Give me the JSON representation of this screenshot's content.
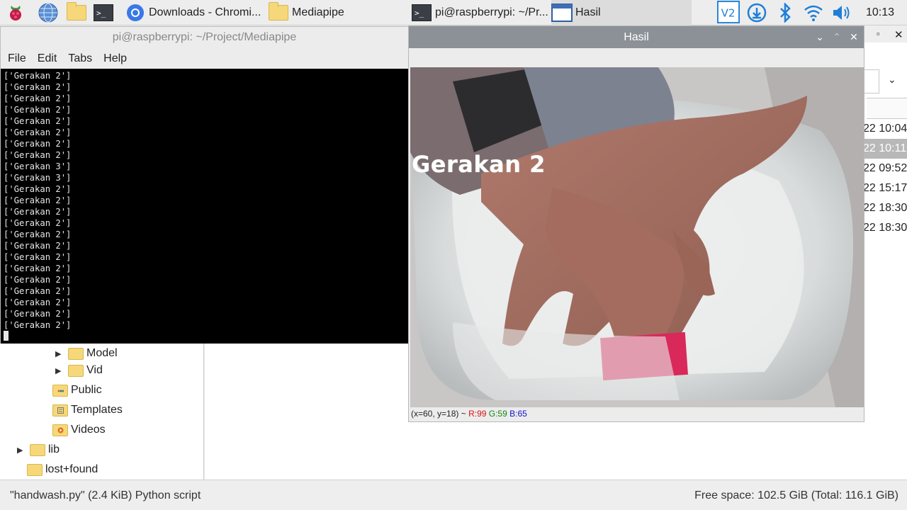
{
  "taskbar": {
    "tasks": [
      {
        "label": "Downloads - Chromi..."
      },
      {
        "label": "Mediapipe"
      },
      {
        "label": "pi@raspberrypi: ~/Pr..."
      },
      {
        "label": "Hasil"
      }
    ],
    "clock": "10:13"
  },
  "terminal": {
    "title": "pi@raspberrypi: ~/Project/Mediapipe",
    "menu": [
      "File",
      "Edit",
      "Tabs",
      "Help"
    ],
    "lines": [
      "['Gerakan 2']",
      "['Gerakan 2']",
      "['Gerakan 2']",
      "['Gerakan 2']",
      "['Gerakan 2']",
      "['Gerakan 2']",
      "['Gerakan 2']",
      "['Gerakan 2']",
      "['Gerakan 3']",
      "['Gerakan 3']",
      "['Gerakan 2']",
      "['Gerakan 2']",
      "['Gerakan 2']",
      "['Gerakan 2']",
      "['Gerakan 2']",
      "['Gerakan 2']",
      "['Gerakan 2']",
      "['Gerakan 2']",
      "['Gerakan 2']",
      "['Gerakan 2']",
      "['Gerakan 2']",
      "['Gerakan 2']",
      "['Gerakan 2']"
    ]
  },
  "file_tree": {
    "items": [
      {
        "label": "Model"
      },
      {
        "label": "Vid"
      },
      {
        "label": "Public"
      },
      {
        "label": "Templates"
      },
      {
        "label": "Videos"
      },
      {
        "label": "lib"
      },
      {
        "label": "lost+found"
      }
    ]
  },
  "file_list": {
    "dates": [
      "22 10:04",
      "22 10:11",
      "22 09:52",
      "22 15:17",
      "22 18:30",
      "22 18:30"
    ]
  },
  "status": {
    "left": "\"handwash.py\" (2.4 KiB) Python script",
    "right": "Free space: 102.5 GiB (Total: 116.1 GiB)"
  },
  "hasil": {
    "title": "Hasil",
    "overlay": "Gerakan 2",
    "pixel_info": "(x=60, y=18) ~",
    "r": "R:99",
    "g": "G:59",
    "b": "B:65"
  },
  "colors": {
    "r_text": "#dd1111",
    "g_text": "#118811",
    "b_text": "#1111cc"
  }
}
